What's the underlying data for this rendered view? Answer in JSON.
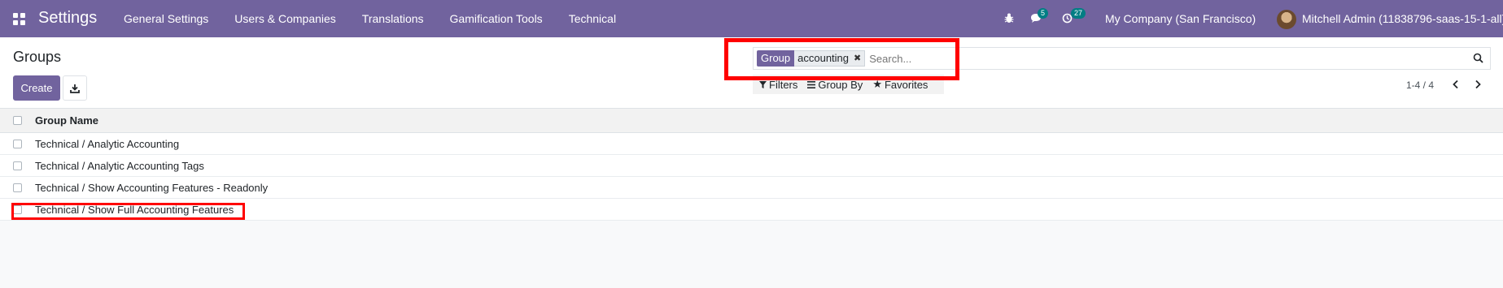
{
  "navbar": {
    "app_title": "Settings",
    "menu": [
      "General Settings",
      "Users & Companies",
      "Translations",
      "Gamification Tools",
      "Technical"
    ],
    "messages_count": "5",
    "activities_count": "27",
    "company": "My Company (San Francisco)",
    "user": "Mitchell Admin (11838796-saas-15-1-all)"
  },
  "control_panel": {
    "title": "Groups",
    "create_label": "Create",
    "search": {
      "facet_label": "Group",
      "facet_value": "accounting",
      "placeholder": "Search..."
    },
    "filters_label": "Filters",
    "groupby_label": "Group By",
    "favorites_label": "Favorites",
    "pager": "1-4 / 4"
  },
  "list": {
    "column_header": "Group Name",
    "rows": [
      "Technical / Analytic Accounting",
      "Technical / Analytic Accounting Tags",
      "Technical / Show Accounting Features - Readonly",
      "Technical / Show Full Accounting Features"
    ]
  },
  "colors": {
    "brand": "#71639e",
    "badge": "#017e84",
    "highlight": "#ff0000"
  }
}
